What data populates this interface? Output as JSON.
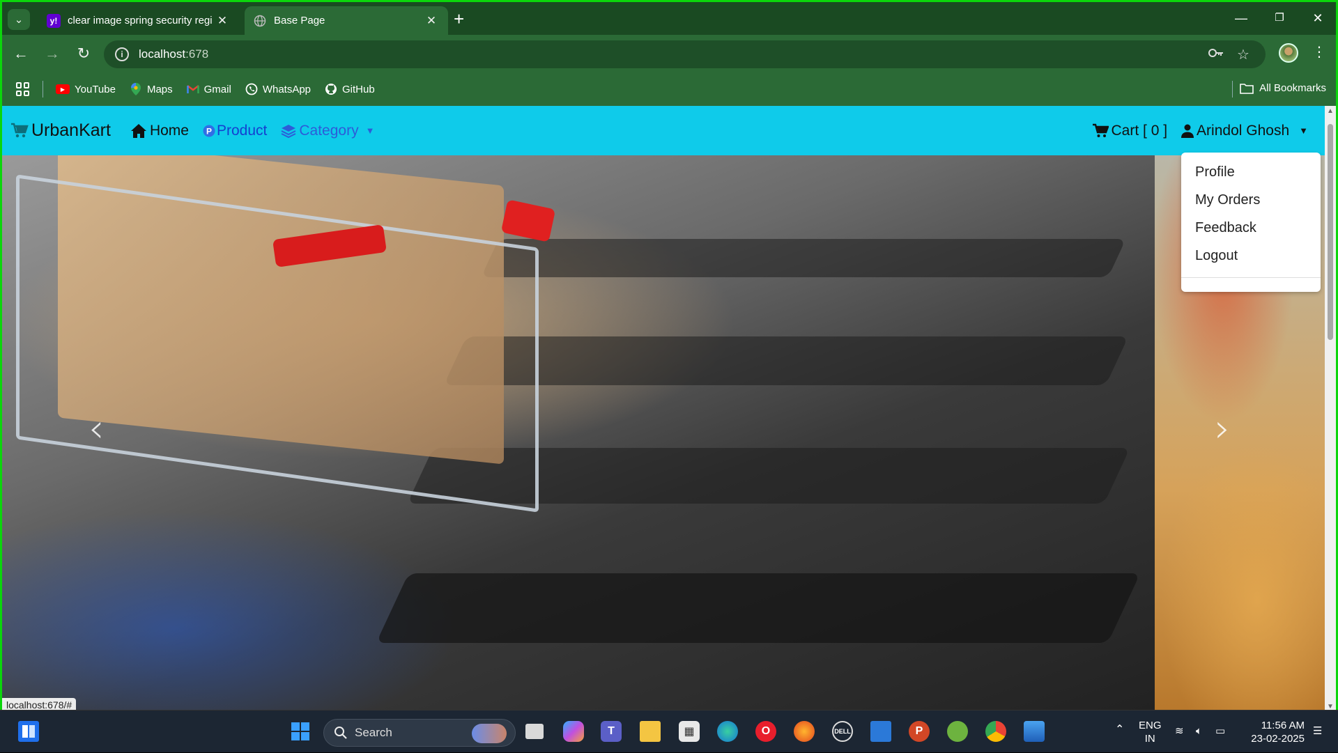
{
  "browser": {
    "tabs": [
      {
        "title": "clear image spring security regi",
        "favicon": "yahoo-icon",
        "active": false
      },
      {
        "title": "Base Page",
        "favicon": "globe-icon",
        "active": true
      }
    ],
    "url_host": "localhost",
    "url_port": ":678",
    "bookmarks": [
      {
        "label": "YouTube",
        "icon": "youtube-icon",
        "color": "#ff0000"
      },
      {
        "label": "Maps",
        "icon": "maps-icon",
        "color": "#34a853"
      },
      {
        "label": "Gmail",
        "icon": "gmail-icon",
        "color": "#ea4335"
      },
      {
        "label": "WhatsApp",
        "icon": "whatsapp-icon",
        "color": "#25d366"
      },
      {
        "label": "GitHub",
        "icon": "github-icon",
        "color": "#ffffff"
      }
    ],
    "all_bookmarks": "All Bookmarks",
    "status_url": "localhost:678/#",
    "accent": "#0bd60b"
  },
  "site": {
    "brand": "UrbanKart",
    "nav": {
      "home": "Home",
      "product": "Product",
      "category": "Category",
      "cart": "Cart [ 0 ]",
      "user": "Arindol Ghosh"
    },
    "navbar_color": "#0fcbea",
    "user_menu": [
      "Profile",
      "My Orders",
      "Feedback",
      "Logout"
    ]
  },
  "taskbar": {
    "search": "Search",
    "lang_1": "ENG",
    "lang_2": "IN",
    "time": "11:56 AM",
    "date": "23-02-2025"
  }
}
